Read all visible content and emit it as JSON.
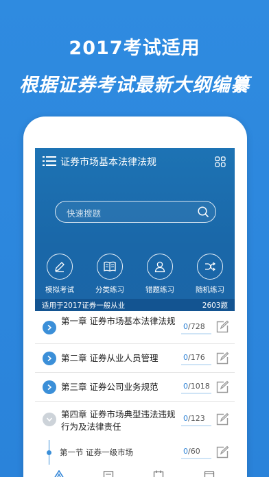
{
  "promo": {
    "title": "2017考试适用",
    "subtitle": "根据证券考试最新大纲编纂"
  },
  "header": {
    "title": "证券市场基本法律法规",
    "menu_icon": "list-menu-icon",
    "grid_icon": "grid-icon"
  },
  "search": {
    "placeholder": "快速搜题"
  },
  "quick_actions": [
    {
      "label": "模拟考试",
      "icon": "pencil-icon"
    },
    {
      "label": "分类练习",
      "icon": "book-icon"
    },
    {
      "label": "错题练习",
      "icon": "user-icon"
    },
    {
      "label": "随机练习",
      "icon": "shuffle-icon"
    }
  ],
  "info": {
    "scope": "适用于2017证券一般从业",
    "total": "2603题"
  },
  "chapters": [
    {
      "title": "第一章 证券市场基本法律法规",
      "done": "0",
      "total": "/728",
      "expanded": false
    },
    {
      "title": "第二章 证券从业人员管理",
      "done": "0",
      "total": "/176",
      "expanded": false
    },
    {
      "title": "第三章 证券公司业务规范",
      "done": "0",
      "total": "/1018",
      "expanded": false
    },
    {
      "title": "第四章 证券市场典型违法违规行为及法律责任",
      "done": "0",
      "total": "/123",
      "expanded": true
    }
  ],
  "sections": [
    {
      "title": "第一节 证券一级市场",
      "done": "0",
      "total": "/60"
    }
  ],
  "colors": {
    "background": "#2f8be0",
    "header": "#1d73b4",
    "accent": "#3b8fd8"
  }
}
